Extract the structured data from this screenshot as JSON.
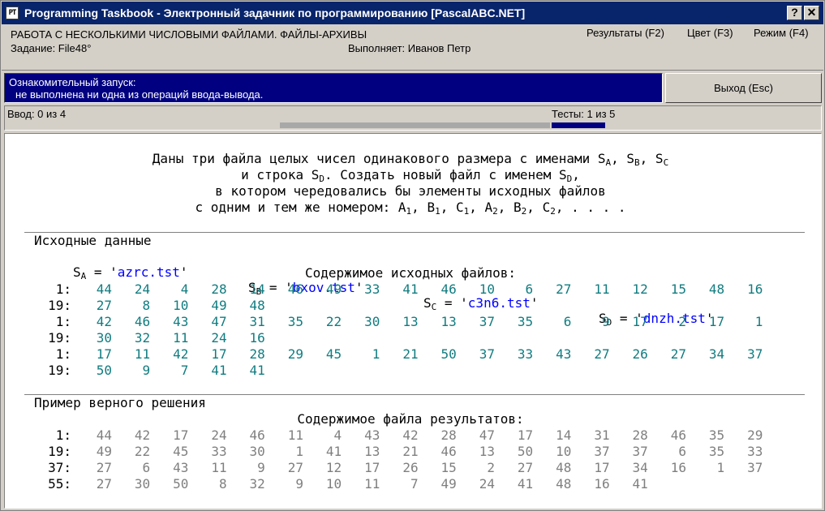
{
  "window": {
    "title": "Programming Taskbook - Электронный задачник по программированию [PascalABC.NET]",
    "icon_text": "PT",
    "help_button": "?",
    "close_button": "✕"
  },
  "header": {
    "topic": "РАБОТА С НЕСКОЛЬКИМИ ЧИСЛОВЫМИ ФАЙЛАМИ. ФАЙЛЫ-АРХИВЫ",
    "task": "Задание: File48°",
    "performer": "Выполняет: Иванов Петр",
    "menu": [
      "Результаты (F2)",
      "Цвет (F3)",
      "Режим (F4)"
    ]
  },
  "info": {
    "line1": "Ознакомительный запуск:",
    "line2": "не выполнена ни одна из операций ввода-вывода."
  },
  "exit_button": "Выход (Esc)",
  "status": {
    "input": "Ввод: 0 из 4",
    "tests": "Тесты: 1 из 5",
    "tests_done_fraction": 0.2
  },
  "task": {
    "lines": [
      "Даны три файла целых чисел одинакового размера с именами S<sub>A</sub>, S<sub>B</sub>, S<sub>C</sub>",
      "и строка S<sub>D</sub>. Создать новый файл с именем S<sub>D</sub>,",
      "в котором чередовались бы элементы исходных файлов",
      "с одним и тем же номером: A<sub>1</sub>, B<sub>1</sub>, C<sub>1</sub>, A<sub>2</sub>, B<sub>2</sub>, C<sub>2</sub>, . . . ."
    ]
  },
  "source": {
    "title": "Исходные данные",
    "files": [
      {
        "label": "S",
        "sub": "A",
        "value": "azrc.tst"
      },
      {
        "label": "S",
        "sub": "B",
        "value": "bxov.tst"
      },
      {
        "label": "S",
        "sub": "C",
        "value": "c3n6.tst"
      },
      {
        "label": "S",
        "sub": "D",
        "value": "dnzh.tst"
      }
    ],
    "contents_label": "Содержимое исходных файлов:",
    "rows": [
      {
        "label": "1:",
        "values": [
          44,
          24,
          4,
          28,
          14,
          46,
          49,
          33,
          41,
          46,
          10,
          6,
          27,
          11,
          12,
          15,
          48,
          16
        ]
      },
      {
        "label": "19:",
        "values": [
          27,
          8,
          10,
          49,
          48
        ]
      },
      {
        "label": "1:",
        "values": [
          42,
          46,
          43,
          47,
          31,
          35,
          22,
          30,
          13,
          13,
          37,
          35,
          6,
          9,
          17,
          2,
          17,
          1
        ]
      },
      {
        "label": "19:",
        "values": [
          30,
          32,
          11,
          24,
          16
        ]
      },
      {
        "label": "1:",
        "values": [
          17,
          11,
          42,
          17,
          28,
          29,
          45,
          1,
          21,
          50,
          37,
          33,
          43,
          27,
          26,
          27,
          34,
          37
        ]
      },
      {
        "label": "19:",
        "values": [
          50,
          9,
          7,
          41,
          41
        ]
      }
    ]
  },
  "example": {
    "title": "Пример верного решения",
    "contents_label": "Содержимое файла результатов:",
    "rows": [
      {
        "label": "1:",
        "values": [
          44,
          42,
          17,
          24,
          46,
          11,
          4,
          43,
          42,
          28,
          47,
          17,
          14,
          31,
          28,
          46,
          35,
          29
        ]
      },
      {
        "label": "19:",
        "values": [
          49,
          22,
          45,
          33,
          30,
          1,
          41,
          13,
          21,
          46,
          13,
          50,
          10,
          37,
          37,
          6,
          35,
          33
        ]
      },
      {
        "label": "37:",
        "values": [
          27,
          6,
          43,
          11,
          9,
          27,
          12,
          17,
          26,
          15,
          2,
          27,
          48,
          17,
          34,
          16,
          1,
          37
        ]
      },
      {
        "label": "55:",
        "values": [
          27,
          30,
          50,
          8,
          32,
          9,
          10,
          11,
          7,
          49,
          24,
          41,
          48,
          16,
          41
        ]
      }
    ]
  }
}
